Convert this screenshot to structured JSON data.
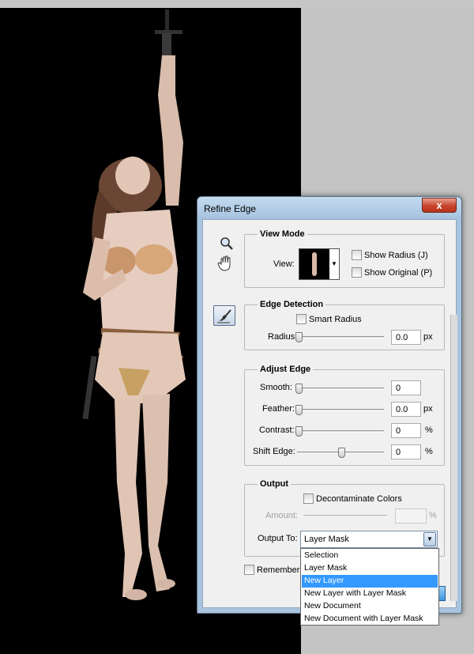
{
  "dialog": {
    "title": "Refine Edge",
    "close_label": "x",
    "view_mode": {
      "heading": "View Mode",
      "view_label": "View:",
      "show_radius": {
        "label": "Show Radius (J)",
        "checked": false
      },
      "show_original": {
        "label": "Show Original (P)",
        "checked": false
      }
    },
    "edge_detection": {
      "heading": "Edge Detection",
      "smart_radius": {
        "label": "Smart Radius",
        "checked": false
      },
      "radius": {
        "label": "Radius:",
        "value": "0.0",
        "unit": "px",
        "level": 0
      }
    },
    "adjust_edge": {
      "heading": "Adjust Edge",
      "smooth": {
        "label": "Smooth:",
        "value": "0",
        "unit": "",
        "level": 0
      },
      "feather": {
        "label": "Feather:",
        "value": "0.0",
        "unit": "px",
        "level": 0
      },
      "contrast": {
        "label": "Contrast:",
        "value": "0",
        "unit": "%",
        "level": 0
      },
      "shift_edge": {
        "label": "Shift Edge:",
        "value": "0",
        "unit": "%",
        "level": 0.5
      }
    },
    "output": {
      "heading": "Output",
      "decontaminate": {
        "label": "Decontaminate Colors",
        "checked": false
      },
      "amount": {
        "label": "Amount:",
        "value": "",
        "unit": "%"
      },
      "output_to": {
        "label": "Output To:",
        "selected": "Layer Mask",
        "options": [
          "Selection",
          "Layer Mask",
          "New Layer",
          "New Layer with Layer Mask",
          "New Document",
          "New Document with Layer Mask"
        ],
        "highlighted": "New Layer"
      }
    },
    "remember_settings": {
      "label": "Remember S",
      "checked": false
    }
  },
  "tools": [
    "zoom-icon",
    "hand-icon",
    "refine-radius-brush-icon"
  ],
  "colors": {
    "dialog_frame": "#a8c4de",
    "client_bg": "#f0f0f0",
    "highlight": "#3399ff",
    "close_red": "#c7442a",
    "canvas": "#000000"
  }
}
